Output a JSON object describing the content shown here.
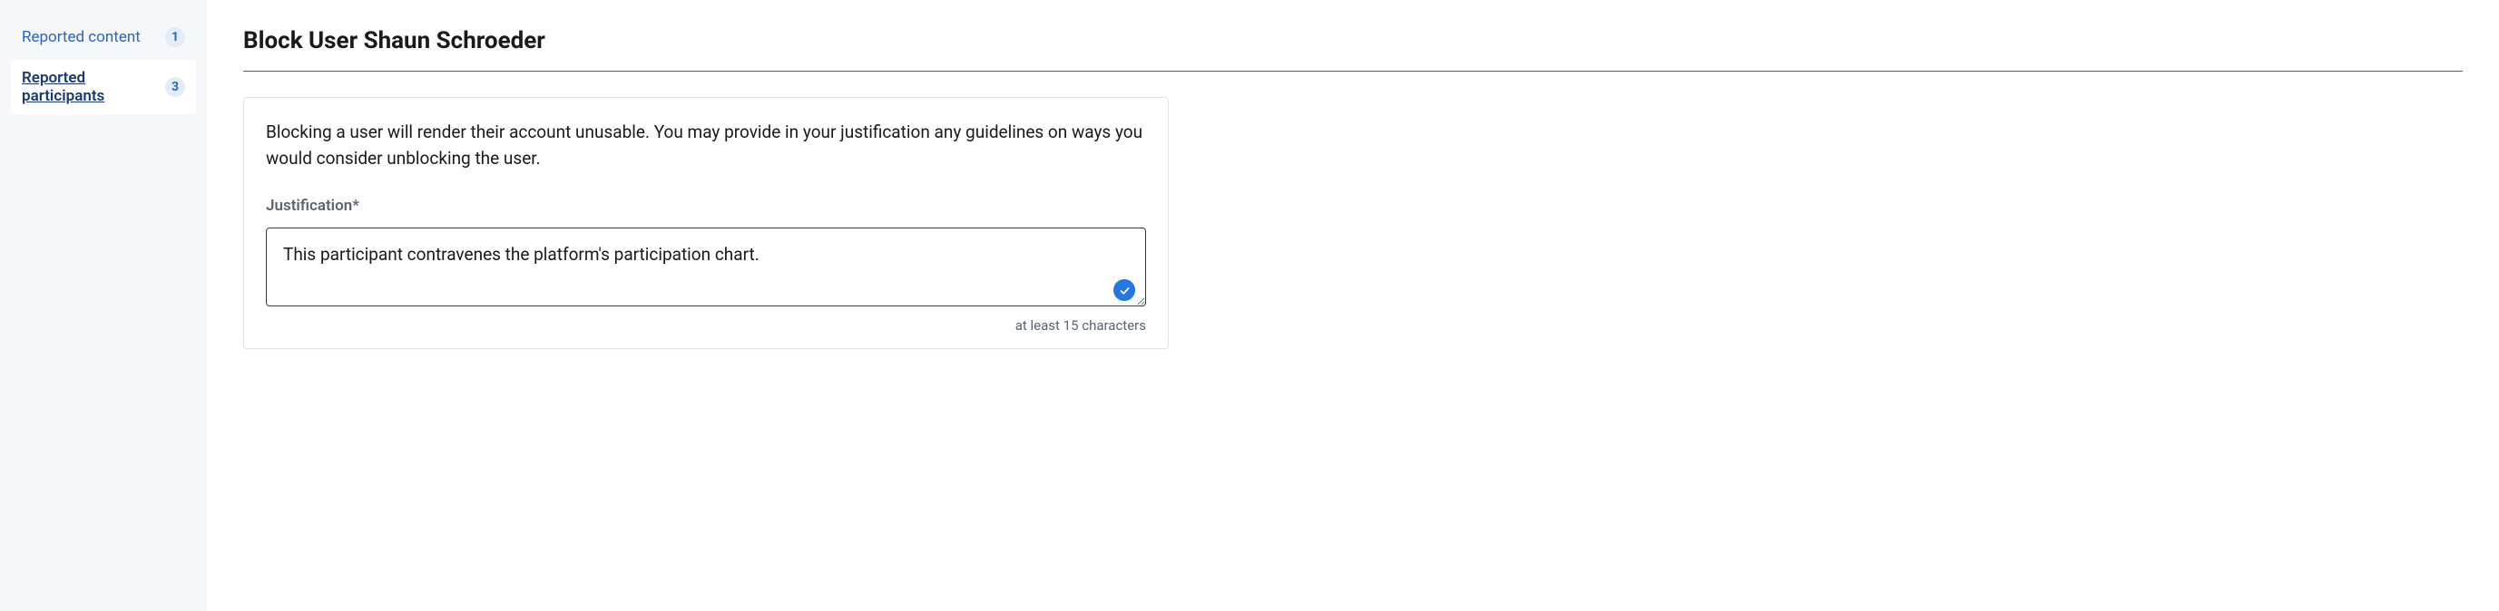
{
  "sidebar": {
    "items": [
      {
        "label": "Reported content",
        "count": "1"
      },
      {
        "label": "Reported participants",
        "count": "3"
      }
    ]
  },
  "main": {
    "title": "Block User Shaun Schroeder",
    "description": "Blocking a user will render their account unusable. You may provide in your justification any guidelines on ways you would consider unblocking the user.",
    "justification_label": "Justification*",
    "justification_value": "This participant contravenes the platform's participation chart.",
    "hint": "at least 15 characters"
  }
}
